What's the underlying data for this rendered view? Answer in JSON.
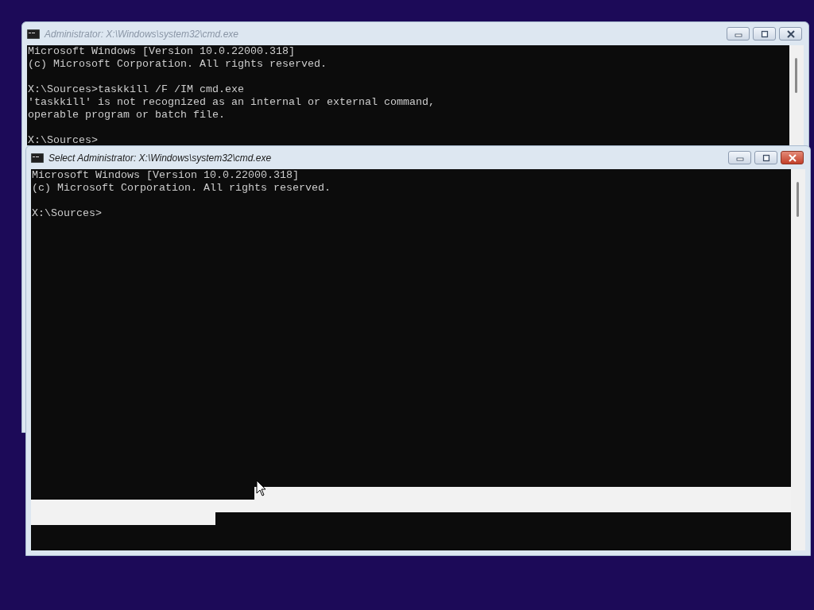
{
  "windows": [
    {
      "title": "Administrator: X:\\Windows\\system32\\cmd.exe",
      "active": false,
      "blocks": [
        [
          "Microsoft Windows [Version 10.0.22000.318]",
          "(c) Microsoft Corporation. All rights reserved."
        ],
        [
          "X:\\Sources>taskkill /F /IM cmd.exe",
          "'taskkill' is not recognized as an internal or external command,",
          "operable program or batch file."
        ],
        [
          "X:\\Sources>"
        ]
      ]
    },
    {
      "title": "Select Administrator: X:\\Windows\\system32\\cmd.exe",
      "active": true,
      "has_selection": true,
      "blocks": [
        [
          "Microsoft Windows [Version 10.0.22000.318]",
          "(c) Microsoft Corporation. All rights reserved."
        ],
        [
          "X:\\Sources>"
        ]
      ]
    }
  ]
}
